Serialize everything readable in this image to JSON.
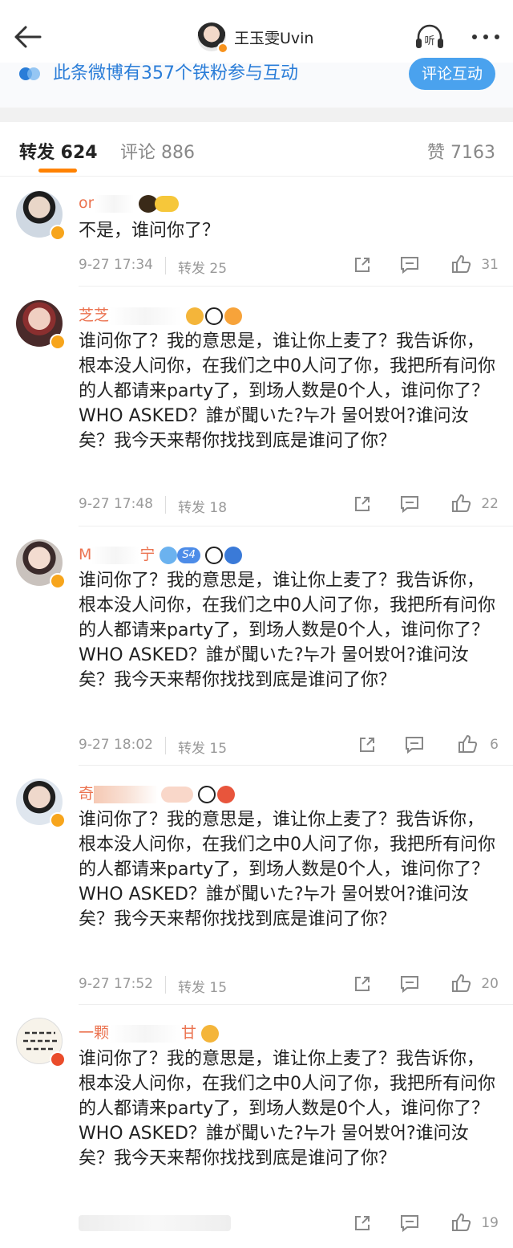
{
  "header": {
    "title": "王玉雯Uvin",
    "listen_label": "听"
  },
  "banner": {
    "text": "此条微博有357个铁粉参与互动",
    "button": "评论互动"
  },
  "tabs": {
    "repost": "转发 624",
    "comment": "评论 886",
    "like": "赞 7163"
  },
  "colors": {
    "accent": "#ff8200",
    "name": "#eb7350",
    "link_blue": "#2a7dd8",
    "button_blue": "#4aa2ee"
  },
  "reposts": [
    {
      "name_visible": "or",
      "text": "不是，谁问你了？",
      "time": "9-27 17:34",
      "repost": "转发 25",
      "likes": "31"
    },
    {
      "name_visible": "芝芝",
      "text": "谁问你了？我的意思是，谁让你上麦了？我告诉你，根本没人问你，在我们之中0人问了你，我把所有问你的人都请来party了，到场人数是0个人，谁问你了？WHO ASKED？誰が聞いた?누가 물어봤어?谁问汝矣？我今天来帮你找找到底是谁问了你？",
      "time": "9-27 17:48",
      "repost": "转发 18",
      "likes": "22"
    },
    {
      "name_visible": "M",
      "name_suffix": "宁",
      "level_badge": "S4",
      "text": "谁问你了？我的意思是，谁让你上麦了？我告诉你，根本没人问你，在我们之中0人问了你，我把所有问你的人都请来party了，到场人数是0个人，谁问你了？WHO ASKED？誰が聞いた?누가 물어봤어?谁问汝矣？我今天来帮你找找到底是谁问了你？",
      "time": "9-27 18:02",
      "repost": "转发 15",
      "likes": "6"
    },
    {
      "name_visible": "奇",
      "text": "谁问你了？我的意思是，谁让你上麦了？我告诉你，根本没人问你，在我们之中0人问了你，我把所有问你的人都请来party了，到场人数是0个人，谁问你了？WHO ASKED？誰が聞いた?누가 물어봤어?谁问汝矣？我今天来帮你找找到底是谁问了你？",
      "time": "9-27 17:52",
      "repost": "转发 15",
      "likes": "20"
    },
    {
      "name_visible": "一颗",
      "name_suffix": "甘",
      "text": "谁问你了？我的意思是，谁让你上麦了？我告诉你，根本没人问你，在我们之中0人问了你，我把所有问你的人都请来party了，到场人数是0个人，谁问你了？WHO ASKED？誰が聞いた?누가 물어봤어?谁问汝矣？我今天来帮你找找到底是谁问了你？",
      "time": "",
      "repost": "",
      "likes": "19"
    }
  ]
}
